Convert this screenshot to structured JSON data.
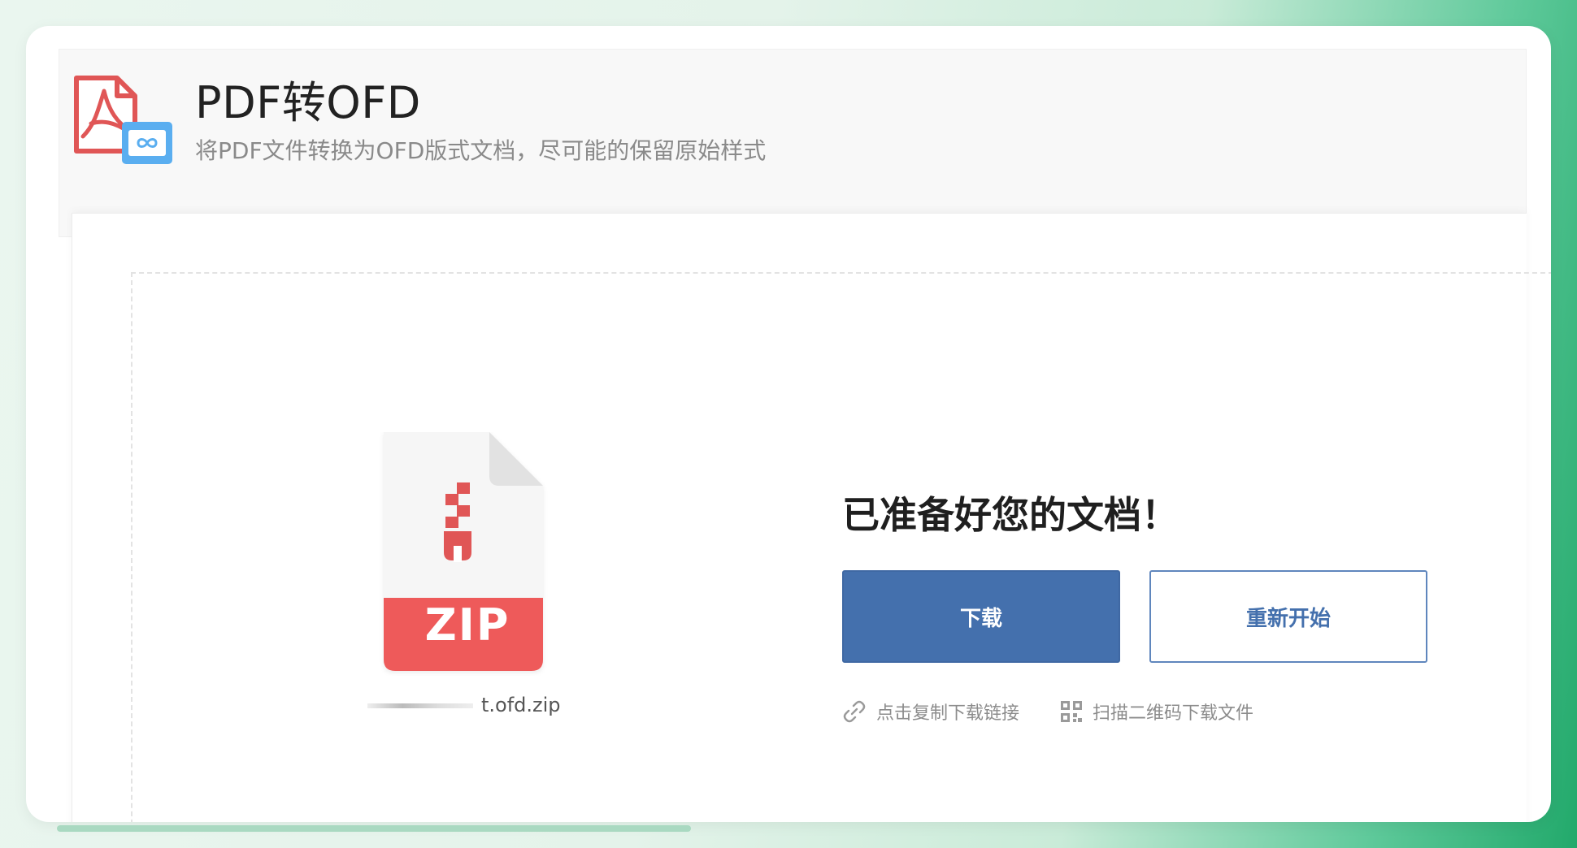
{
  "header": {
    "title": "PDF转OFD",
    "subtitle": "将PDF文件转换为OFD版式文档，尽可能的保留原始样式",
    "logo_icon": "pdf-to-ofd-icon"
  },
  "result": {
    "heading": "已准备好您的文档！",
    "file_type_label": "ZIP",
    "file_name": "t.ofd.zip",
    "download_label": "下载",
    "restart_label": "重新开始",
    "copy_link_label": "点击复制下载链接",
    "qr_label": "扫描二维码下载文件"
  },
  "colors": {
    "primary": "#4470ad",
    "pdf_red": "#e05656",
    "ofd_blue": "#5aaef0",
    "zip_red": "#ee5a5a"
  }
}
